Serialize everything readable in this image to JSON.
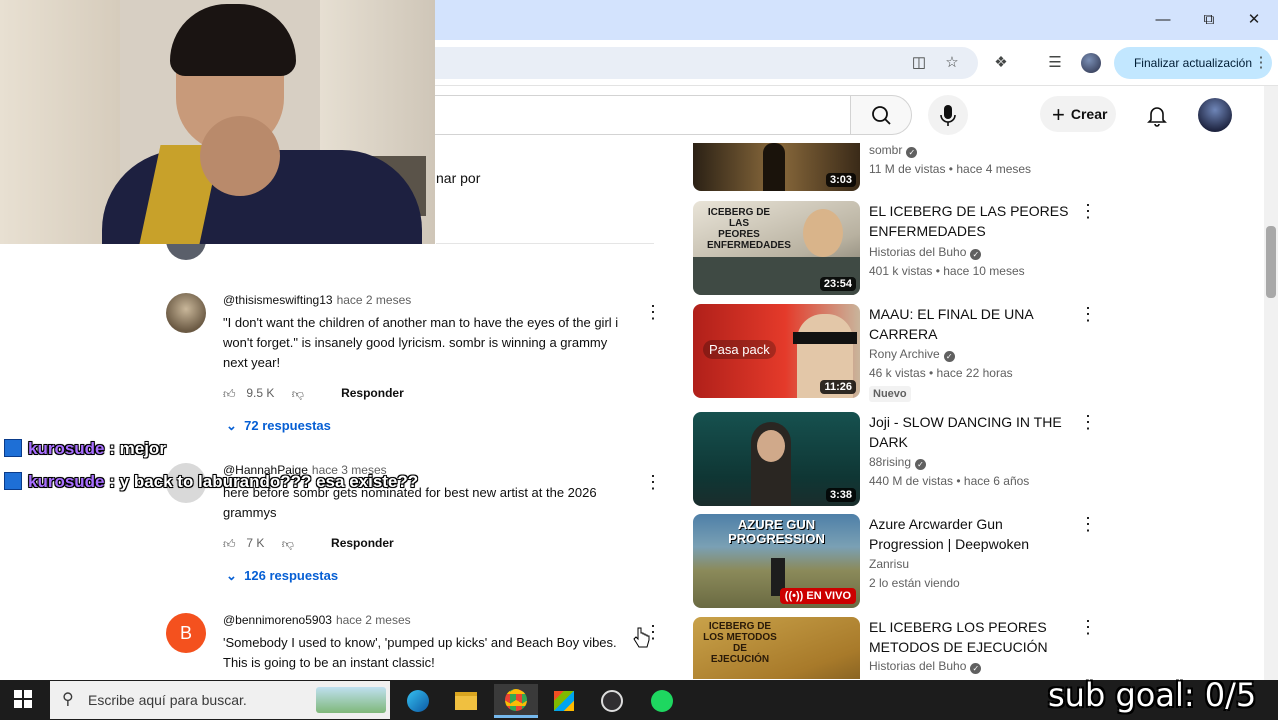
{
  "browser": {
    "update_button": "Finalizar actualización"
  },
  "youtube": {
    "create_label": "Crear"
  },
  "comments": {
    "sort_label": "nar por",
    "items": [
      {
        "handle": "@thisismeswifting13",
        "time": "hace 2 meses",
        "text": "\"I don't want the children of another man to have the eyes of the girl i won't forget.\" is insanely good lyricism. sombr is winning a grammy next year!",
        "likes": "9.5 K",
        "reply_label": "Responder",
        "replies": "72 respuestas"
      },
      {
        "handle": "@HannahPaige",
        "time": "hace 3 meses",
        "text": "here before sombr gets nominated for best new artist at the 2026 grammys",
        "likes": "7 K",
        "reply_label": "Responder",
        "replies": "126 respuestas"
      },
      {
        "handle": "@bennimoreno5903",
        "time": "hace 2 meses",
        "avatar_letter": "B",
        "text": "'Somebody I used to know', 'pumped up kicks' and Beach Boy vibes. This is going to be an instant classic!"
      }
    ]
  },
  "chat": [
    {
      "user": "kurosude",
      "message": " : mejor"
    },
    {
      "user": "kurosude",
      "message": " : y back to laburando??? esa existe??"
    }
  ],
  "sidebar": {
    "videos": [
      {
        "title": "",
        "channel": "sombr",
        "meta": "11 M de vistas • hace 4 meses",
        "duration": "3:03"
      },
      {
        "title": "EL ICEBERG DE LAS PEORES ENFERMEDADES",
        "channel": "Historias del Buho",
        "meta": "401 k vistas • hace 10 meses",
        "duration": "23:54",
        "thumb_text": "ICEBERG DE LAS PEORES ENFERMEDADES"
      },
      {
        "title": "MAAU: EL FINAL DE UNA CARRERA",
        "channel": "Rony Archive",
        "meta": "46 k vistas • hace 22 horas",
        "badge": "Nuevo",
        "duration": "11:26",
        "thumb_text": "Pasa pack"
      },
      {
        "title": "Joji - SLOW DANCING IN THE DARK",
        "channel": "88rising",
        "meta": "440 M de vistas • hace 6 años",
        "duration": "3:38"
      },
      {
        "title": "Azure Arcwarder Gun Progression | Deepwoken",
        "channel": "Zanrisu",
        "meta": "2 lo están viendo",
        "live": "EN VIVO",
        "thumb_text": "AZURE GUN PROGRESSION"
      },
      {
        "title": "EL ICEBERG LOS PEORES METODOS DE EJECUCIÓN",
        "channel": "Historias del Buho",
        "meta": "",
        "thumb_text": "ICEBERG DE LOS METODOS DE EJECUCIÓN"
      }
    ]
  },
  "taskbar": {
    "search_placeholder": "Escribe aquí para buscar."
  },
  "overlay": {
    "subgoal": "sub goal: 0/5"
  }
}
